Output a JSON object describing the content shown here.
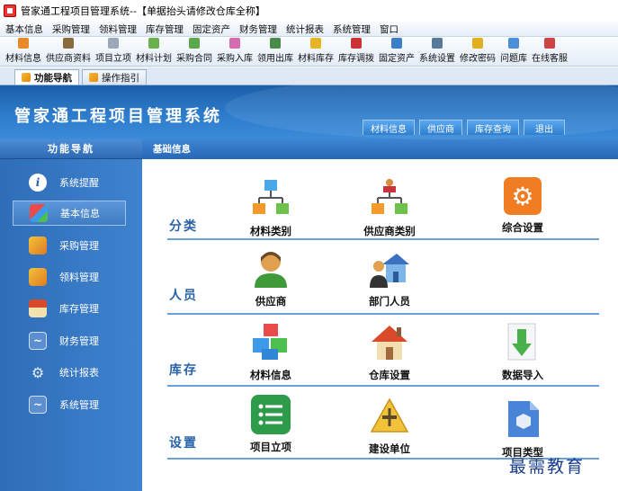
{
  "window": {
    "title": "管家通工程项目管理系统--【单据抬头请修改仓库全称】"
  },
  "menu": [
    "基本信息",
    "采购管理",
    "领料管理",
    "库存管理",
    "固定资产",
    "财务管理",
    "统计报表",
    "系统管理",
    "窗口"
  ],
  "toolbar": [
    "材料信息",
    "供应商资料",
    "项目立项",
    "材料计划",
    "采购合同",
    "采购入库",
    "领用出库",
    "材料库存",
    "库存调拨",
    "固定资产",
    "系统设置",
    "修改密码",
    "问题库",
    "在线客服"
  ],
  "tabs": [
    "功能导航",
    "操作指引"
  ],
  "header": {
    "app_title": "管家通工程项目管理系统",
    "buttons": [
      "材料信息",
      "供应商",
      "库存查询",
      "退出"
    ]
  },
  "sidebar": {
    "heading": "功能导航",
    "items": [
      "系统提醒",
      "基本信息",
      "采购管理",
      "领料管理",
      "库存管理",
      "财务管理",
      "统计报表",
      "系统管理"
    ],
    "selected": "基本信息"
  },
  "main": {
    "heading": "基础信息",
    "sections": [
      {
        "label": "分类",
        "tiles": [
          "材料类别",
          "供应商类别",
          "综合设置"
        ]
      },
      {
        "label": "人员",
        "tiles": [
          "供应商",
          "部门人员"
        ]
      },
      {
        "label": "库存",
        "tiles": [
          "材料信息",
          "仓库设置",
          "数据导入"
        ]
      },
      {
        "label": "设置",
        "tiles": [
          "项目立项",
          "建设单位",
          "项目类型"
        ]
      }
    ]
  },
  "watermark": "最需教育",
  "colors": {
    "accent": "#2e6ab4",
    "banner": "#2d7ccc",
    "section_text": "#2a62a8",
    "settings_tile": "#f07d22",
    "project_tile": "#2e9b4a"
  }
}
